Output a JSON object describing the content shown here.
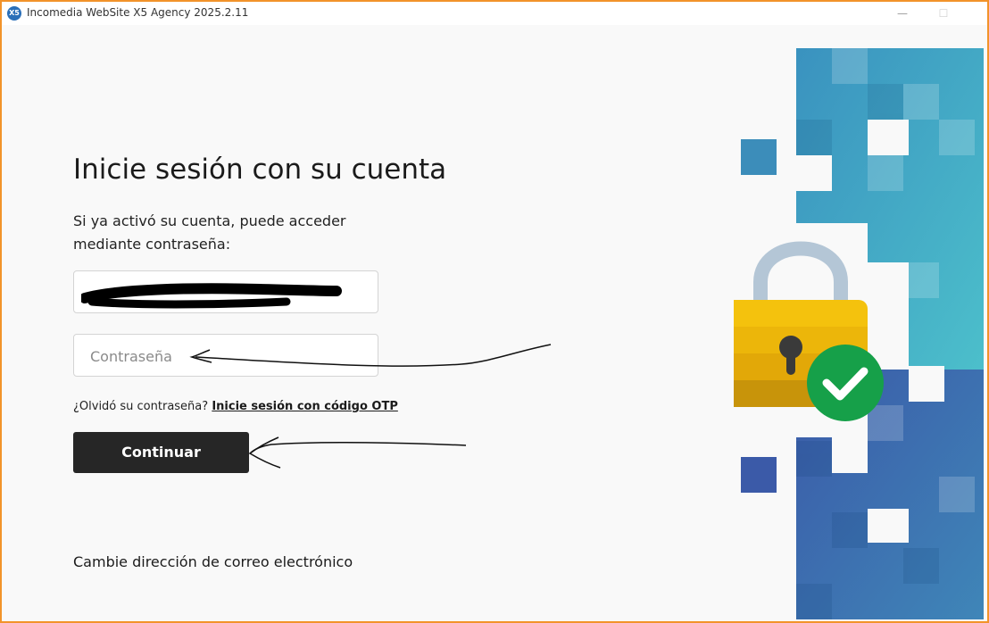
{
  "window": {
    "title": "Incomedia WebSite X5 Agency 2025.2.11",
    "icon": "websitex5-app-icon",
    "icon_text": "X5",
    "minimize_glyph": "—",
    "maximize_glyph": "☐"
  },
  "login": {
    "heading": "Inicie sesión con su cuenta",
    "subtitle": "Si ya activó su cuenta, puede acceder mediante contraseña:",
    "password_placeholder": "Contraseña",
    "forgot_text": "¿Olvidó su contraseña?",
    "otp_link": "Inicie sesión con código OTP",
    "continue_label": "Continuar",
    "change_email": "Cambie dirección de correo electrónico"
  },
  "colors": {
    "accent_border": "#f2932a",
    "button_bg": "#262626",
    "lock_gold": "#f4c20d",
    "check_green": "#16a049"
  }
}
